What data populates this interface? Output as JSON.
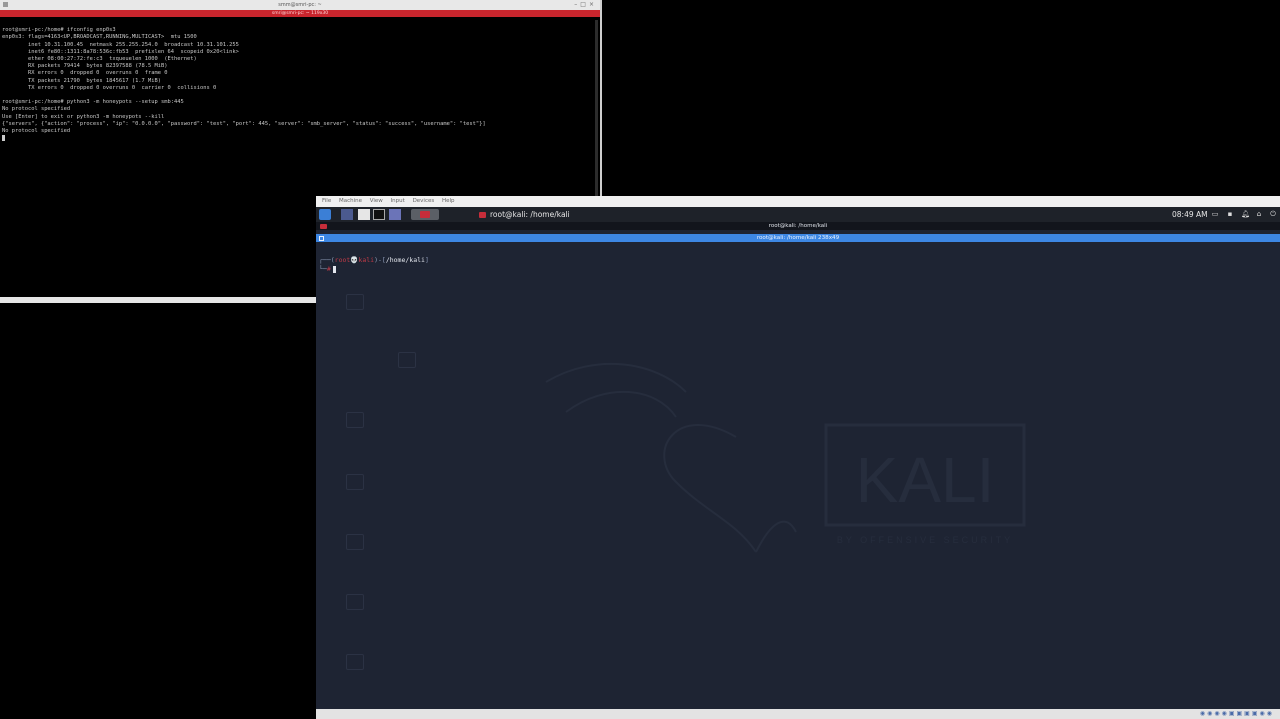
{
  "host_terminal": {
    "window_title": "smm@smri-pc: ~",
    "tab_title": "smri@smri-pc: ~ 119x30",
    "lines": [
      "root@smri-pc:/home# ifconfig enp0s3",
      "enp0s3: flags=4163<UP,BROADCAST,RUNNING,MULTICAST>  mtu 1500",
      "        inet 10.31.100.45  netmask 255.255.254.0  broadcast 10.31.101.255",
      "        inet6 fe80::1311:8a78:536c:fb53  prefixlen 64  scopeid 0x20<link>",
      "        ether 08:00:27:72:fe:c3  txqueuelen 1000  (Ethernet)",
      "        RX packets 79414  bytes 82397588 (78.5 MiB)",
      "        RX errors 0  dropped 0  overruns 0  frame 0",
      "        TX packets 21790  bytes 1845617 (1.7 MiB)",
      "        TX errors 0  dropped 0 overruns 0  carrier 0  collisions 0",
      "",
      "root@smri-pc:/home# python3 -m honeypots --setup smb:445",
      "No protocol specified",
      "Use [Enter] to exit or python3 -m honeypots --kill",
      "{\"servers\", {\"action\": \"process\", \"ip\": \"0.0.0.0\", \"password\": \"test\", \"port\": 445, \"server\": \"smb_server\", \"status\": \"success\", \"username\": \"test\"}]",
      "No protocol specified"
    ]
  },
  "vm": {
    "menu": [
      "File",
      "Machine",
      "View",
      "Input",
      "Devices",
      "Help"
    ],
    "taskbar_title": "root@kali: /home/kali",
    "clock": "08:49 AM",
    "window_title": "root@kali: /home/kali",
    "tab_title": "root@kali: /home/kali 238x49",
    "prompt": {
      "open": "┌──(",
      "user": "root",
      "skull": "💀",
      "host": "kali",
      "mid": ")-[",
      "path": "/home/kali",
      "close": "]",
      "line2": "└─",
      "symbol": "#"
    },
    "wallpaper_text": "KALI",
    "wallpaper_tagline": "BY OFFENSIVE SECURITY"
  },
  "colors": {
    "host_tab_red": "#c9252d",
    "kali_tab_blue": "#3d87e4",
    "kali_bg": "#1e2433",
    "kali_panel": "#1e2229"
  }
}
